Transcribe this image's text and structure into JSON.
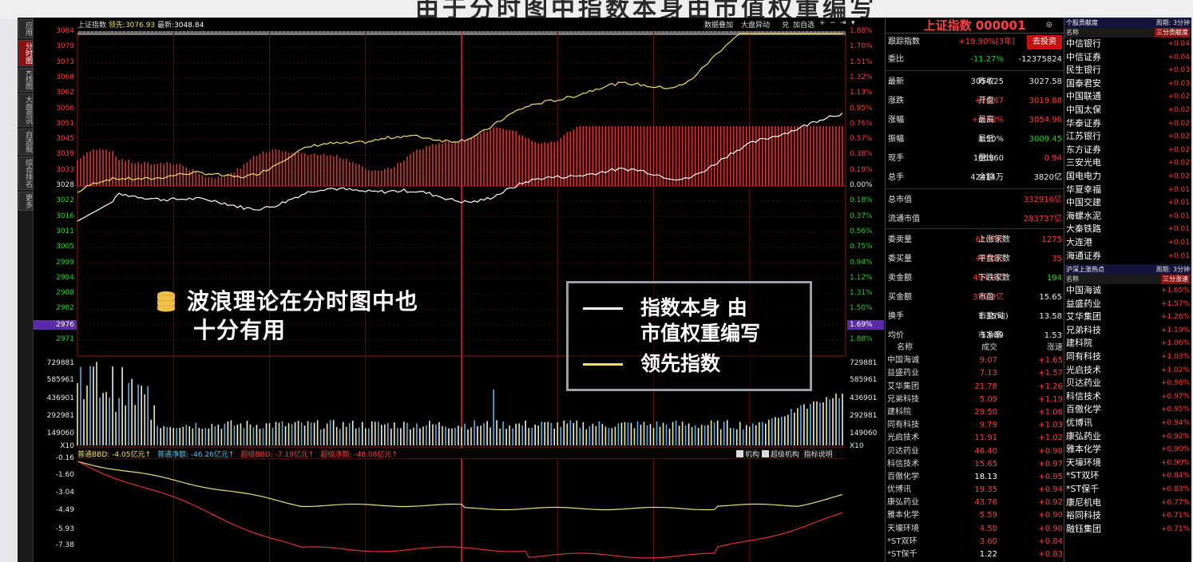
{
  "slide": {
    "title": "由于分时图中指数本身由市值权重编写"
  },
  "sidebar": {
    "tabs": [
      "应用",
      "分时图",
      "K线图",
      "大盘资讯",
      "自选股",
      "综合排名",
      "更多"
    ]
  },
  "header": {
    "index_label": "上证指数",
    "lead_label": "领先:",
    "lead_value": "3076.93",
    "latest_label": "最新:",
    "latest_value": "3048.84",
    "buttons": [
      "数据叠加",
      "大盘异动",
      "兑",
      "加自选"
    ]
  },
  "axis": {
    "price_ticks": [
      "3084",
      "3079",
      "3073",
      "3068",
      "3062",
      "3056",
      "3051",
      "3045",
      "3039",
      "3033",
      "3028",
      "3022",
      "3016",
      "3011",
      "3005",
      "2999",
      "2994",
      "2988",
      "2982",
      "2976",
      "2971"
    ],
    "pct_ticks": [
      "1.88%",
      "1.70%",
      "1.51%",
      "1.32%",
      "1.13%",
      "0.95%",
      "0.76%",
      "0.57%",
      "0.38%",
      "0.19%",
      "0.00%",
      "0.18%",
      "0.37%",
      "0.56%",
      "0.75%",
      "0.94%",
      "1.12%",
      "1.31%",
      "1.50%",
      "1.69%",
      "1.88%"
    ],
    "vol_ticks": [
      "729881",
      "585961",
      "436901",
      "292981",
      "149060",
      "X10"
    ],
    "bbd_ticks": [
      "-0.16",
      "-1.60",
      "-3.04",
      "-4.49",
      "-5.93",
      "-7.38"
    ]
  },
  "bbd": {
    "items": [
      "普通BBD: -4.05亿元↑",
      "普通净额: -46.26亿元↑",
      "超级BBD: -7.19亿元↑",
      "超级净额: -48.08亿元↑"
    ],
    "checks": [
      "机构",
      "超级机构"
    ],
    "explain": "指标说明"
  },
  "overlay": {
    "line1": "波浪理论在分时图中也",
    "line2": "十分有用"
  },
  "legend": {
    "white_text1": "指数本身  由",
    "white_text2": "市值权重编写",
    "yellow_text": "领先指数"
  },
  "quote": {
    "title": "上证指数 000001",
    "track_label": "跟踪指数",
    "track_value": "+19.90%[3年]",
    "invest_btn": "去投资",
    "rows": [
      [
        "委比",
        "-11.27%",
        "",
        "-12375824"
      ],
      [
        "最新",
        "3054.25",
        "昨收",
        "3027.58"
      ],
      [
        "涨跌",
        "+26.67",
        "开盘",
        "3019.88"
      ],
      [
        "涨幅",
        "+0.88%",
        "最高",
        "3054.96"
      ],
      [
        "振幅",
        "1.50%",
        "最低",
        "3009.45"
      ],
      [
        "现手",
        "106960",
        "量比",
        "0.94"
      ],
      [
        "总手",
        "42414万",
        "金额",
        "3820亿"
      ],
      [
        "总市值",
        "",
        "",
        "332916亿"
      ],
      [
        "流通市值",
        "",
        "",
        "283737亿"
      ],
      [
        "委卖量",
        "6107万",
        "上涨家数",
        "1275"
      ],
      [
        "委买量",
        "4870万",
        "平盘家数",
        "35"
      ],
      [
        "卖金额",
        "494.9亿",
        "下跌家数",
        "194"
      ],
      [
        "买金额",
        "370.9亿",
        "市盈",
        "15.65"
      ],
      [
        "换手",
        "1.35%",
        "市盈(动)",
        "13.58"
      ],
      [
        "均价",
        "13.89",
        "市净率",
        "1.53"
      ]
    ],
    "list_head": [
      "名称",
      "成交",
      "涨速"
    ],
    "list": [
      [
        "中国海诚",
        "9.07",
        "+1.65"
      ],
      [
        "益盛药业",
        "7.13",
        "+1.57"
      ],
      [
        "艾华集团",
        "21.78",
        "+1.26"
      ],
      [
        "兄弟科技",
        "5.09",
        "+1.19"
      ],
      [
        "建科院",
        "29.50",
        "+1.06"
      ],
      [
        "同有科技",
        "9.79",
        "+1.03"
      ],
      [
        "光启技术",
        "11.91",
        "+1.02"
      ],
      [
        "贝达药业",
        "46.40",
        "+0.98"
      ],
      [
        "科信技术",
        "15.65",
        "+0.97"
      ],
      [
        "百傲化学",
        "18.13",
        "+0.95"
      ],
      [
        "优博讯",
        "19.35",
        "+0.94"
      ],
      [
        "康弘药业",
        "43.76",
        "+0.92"
      ],
      [
        "雅本化学",
        "5.59",
        "+0.90"
      ],
      [
        "天壕环境",
        "4.50",
        "+0.90"
      ],
      [
        "*ST双环",
        "3.60",
        "+0.84"
      ],
      [
        "*ST保千",
        "1.22",
        "+0.83"
      ]
    ]
  },
  "far": {
    "h1": "个股贡献度",
    "h1r": "周期: 3分钟",
    "sub1": "名称",
    "sub1r": "三分贡献度",
    "list1": [
      [
        "中信银行",
        "+0.04"
      ],
      [
        "中信证券",
        "+0.04"
      ],
      [
        "民生银行",
        "+0.03"
      ],
      [
        "国泰君安",
        "+0.03"
      ],
      [
        "中国联通",
        "+0.02"
      ],
      [
        "中国太保",
        "+0.02"
      ],
      [
        "华泰证券",
        "+0.02"
      ],
      [
        "江苏银行",
        "+0.02"
      ],
      [
        "东方证券",
        "+0.02"
      ],
      [
        "三安光电",
        "+0.02"
      ],
      [
        "国电电力",
        "+0.02"
      ],
      [
        "华夏幸福",
        "+0.01"
      ],
      [
        "中国交建",
        "+0.01"
      ],
      [
        "海螺水泥",
        "+0.01"
      ],
      [
        "大秦铁路",
        "+0.01"
      ],
      [
        "大连港",
        "+0.01"
      ],
      [
        "海通证券",
        "+0.01"
      ]
    ],
    "h2": "沪深上涨热点",
    "h2r": "周期: 3分钟",
    "sub2": "名称",
    "sub2r": "三分涨速",
    "list2": [
      [
        "中国海诚",
        "+1.65%"
      ],
      [
        "益盛药业",
        "+1.57%"
      ],
      [
        "艾华集团",
        "+1.26%"
      ],
      [
        "兄弟科技",
        "+1.19%"
      ],
      [
        "建科院",
        "+1.06%"
      ],
      [
        "同有科技",
        "+1.03%"
      ],
      [
        "光启技术",
        "+1.02%"
      ],
      [
        "贝达药业",
        "+0.98%"
      ],
      [
        "科信技术",
        "+0.97%"
      ],
      [
        "百傲化学",
        "+0.95%"
      ],
      [
        "优博讯",
        "+0.94%"
      ],
      [
        "康弘药业",
        "+0.92%"
      ],
      [
        "雅本化学",
        "+0.90%"
      ],
      [
        "天壕环境",
        "+0.90%"
      ],
      [
        "*ST双环",
        "+0.84%"
      ],
      [
        "*ST保千",
        "+0.83%"
      ],
      [
        "康尼机电",
        "+0.77%"
      ],
      [
        "裕同科技",
        "+0.71%"
      ],
      [
        "融钰集团",
        "+0.71%"
      ]
    ]
  },
  "colors": {
    "up": "#ff3b3b",
    "down": "#27d127",
    "index_line": "#ffffff",
    "lead_line": "#f0e060"
  }
}
